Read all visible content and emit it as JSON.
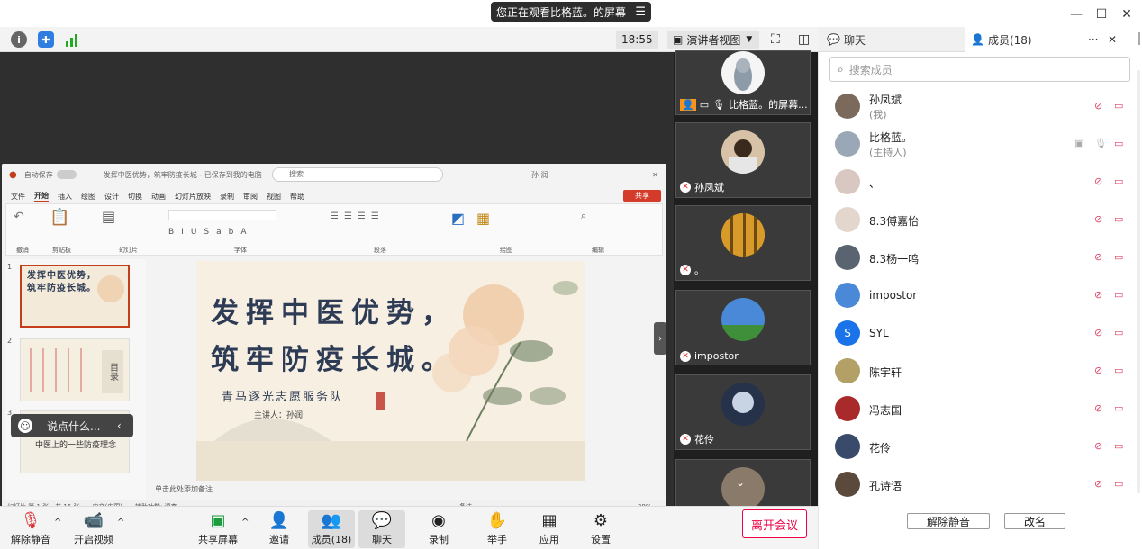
{
  "banner": {
    "text": "您正在观看比格蓝。的屏幕"
  },
  "toolbar": {
    "time": "18:55",
    "view_mode": "演讲者视图"
  },
  "right_header": {
    "chat_tab": "聊天",
    "members_tab": "成员(18)"
  },
  "ppt": {
    "filename": "发挥中医优势，筑牢防疫长城 - 已保存到我的电脑",
    "search": "搜索",
    "autosave": "自动保存",
    "user": "孙 润",
    "share": "共享",
    "menu": [
      "文件",
      "开始",
      "插入",
      "绘图",
      "设计",
      "切换",
      "动画",
      "幻灯片放映",
      "录制",
      "审阅",
      "视图",
      "帮助"
    ],
    "ribbon_groups": [
      "撤消",
      "剪贴板",
      "幻灯片",
      "字体",
      "段落",
      "绘图",
      "编辑"
    ],
    "slide_title_line1": "发挥中医优势，",
    "slide_title_line2": "筑牢防疫长城。",
    "slide_subtitle": "青马逐光志愿服务队",
    "slide_speaker": "主讲人：孙润",
    "thumb3_text": "中医上的一些防疫理念",
    "thumb2_label": "目录",
    "notes_placeholder": "单击此处添加备注",
    "status_left": "幻灯片 第 1 张，共 15 张",
    "status_lang": "中文(中国)",
    "status_access": "辅助功能: 调查",
    "zoom": "39%",
    "notes_btn": "备注",
    "chat_placeholder": "说点什么..."
  },
  "video_tiles": [
    {
      "name": "比格蓝。的屏幕..."
    },
    {
      "name": "孙凤斌"
    },
    {
      "name": "。"
    },
    {
      "name": "impostor"
    },
    {
      "name": "花伶"
    }
  ],
  "members": {
    "search_placeholder": "搜索成员",
    "list": [
      {
        "name": "孙凤斌",
        "sub": "(我)"
      },
      {
        "name": "比格蓝。",
        "sub": "(主持人)"
      },
      {
        "name": "、",
        "sub": ""
      },
      {
        "name": "8.3傅嘉怡",
        "sub": ""
      },
      {
        "name": "8.3杨一鸣",
        "sub": ""
      },
      {
        "name": "impostor",
        "sub": ""
      },
      {
        "name": "SYL",
        "sub": "",
        "avatar_text": "S"
      },
      {
        "name": "陈宇轩",
        "sub": ""
      },
      {
        "name": "冯志国",
        "sub": ""
      },
      {
        "name": "花伶",
        "sub": ""
      },
      {
        "name": "孔诗语",
        "sub": ""
      }
    ],
    "unmute_all": "解除静音",
    "rename": "改名"
  },
  "bottom": {
    "unmute": "解除静音",
    "video": "开启视频",
    "share": "共享屏幕",
    "invite": "邀请",
    "members": "成员(18)",
    "chat": "聊天",
    "record": "录制",
    "raise": "举手",
    "apps": "应用",
    "settings": "设置",
    "leave": "离开会议"
  },
  "colors": {
    "accent_red": "#e0304a",
    "slide_title": "#2d3b55",
    "share_btn": "#d43b2b"
  }
}
